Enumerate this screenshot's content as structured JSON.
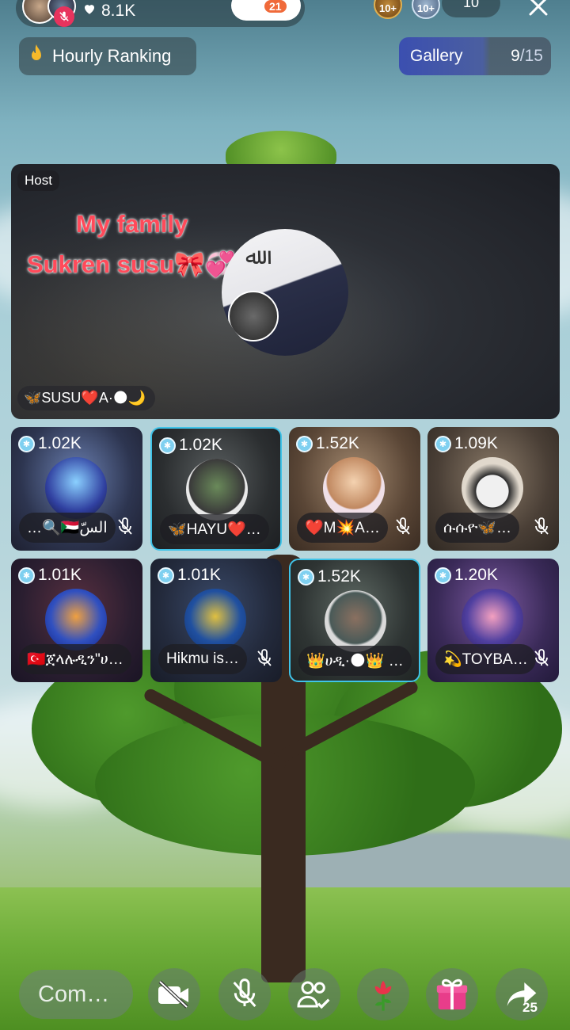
{
  "top": {
    "likes": "8.1K",
    "follow_count": "21",
    "level_badges": [
      "10+",
      "10+"
    ],
    "viewers": "10"
  },
  "ranking": {
    "label": "Hourly Ranking"
  },
  "gallery": {
    "label": "Gallery",
    "current": "9",
    "total": "/15"
  },
  "host": {
    "badge": "Host",
    "banner_line1": "My family",
    "banner_line2": "Sukren susu🎀💞",
    "name": "🦋SUSU❤️A·🌑🌙"
  },
  "seats": [
    {
      "score": "1.02K",
      "name": "…🔍🇸🇩السّ",
      "muted": true,
      "active": false
    },
    {
      "score": "1.02K",
      "name": "🦋HAYU❤️…",
      "muted": false,
      "active": true
    },
    {
      "score": "1.52K",
      "name": "❤️M💥A…",
      "muted": true,
      "active": false
    },
    {
      "score": "1.09K",
      "name": "ሱሱዮ🦋…",
      "muted": true,
      "active": false
    },
    {
      "score": "1.01K",
      "name": "🇹🇷ጀላሉዲን\"ሀ…",
      "muted": false,
      "active": false
    },
    {
      "score": "1.01K",
      "name": "Hikmu is…",
      "muted": true,
      "active": false
    },
    {
      "score": "1.52K",
      "name": "👑ሀዲ·🌑👑 …",
      "muted": false,
      "active": true
    },
    {
      "score": "1.20K",
      "name": "💫TOYBA…",
      "muted": true,
      "active": false
    }
  ],
  "bottom": {
    "comment_placeholder": "Com…",
    "share_count": "25"
  },
  "colors": {
    "accent_cyan": "#3fc3e8",
    "mute_red": "#e8335d",
    "gallery_blue": "#3b4fb0",
    "banner_red": "#ff4a5a"
  }
}
